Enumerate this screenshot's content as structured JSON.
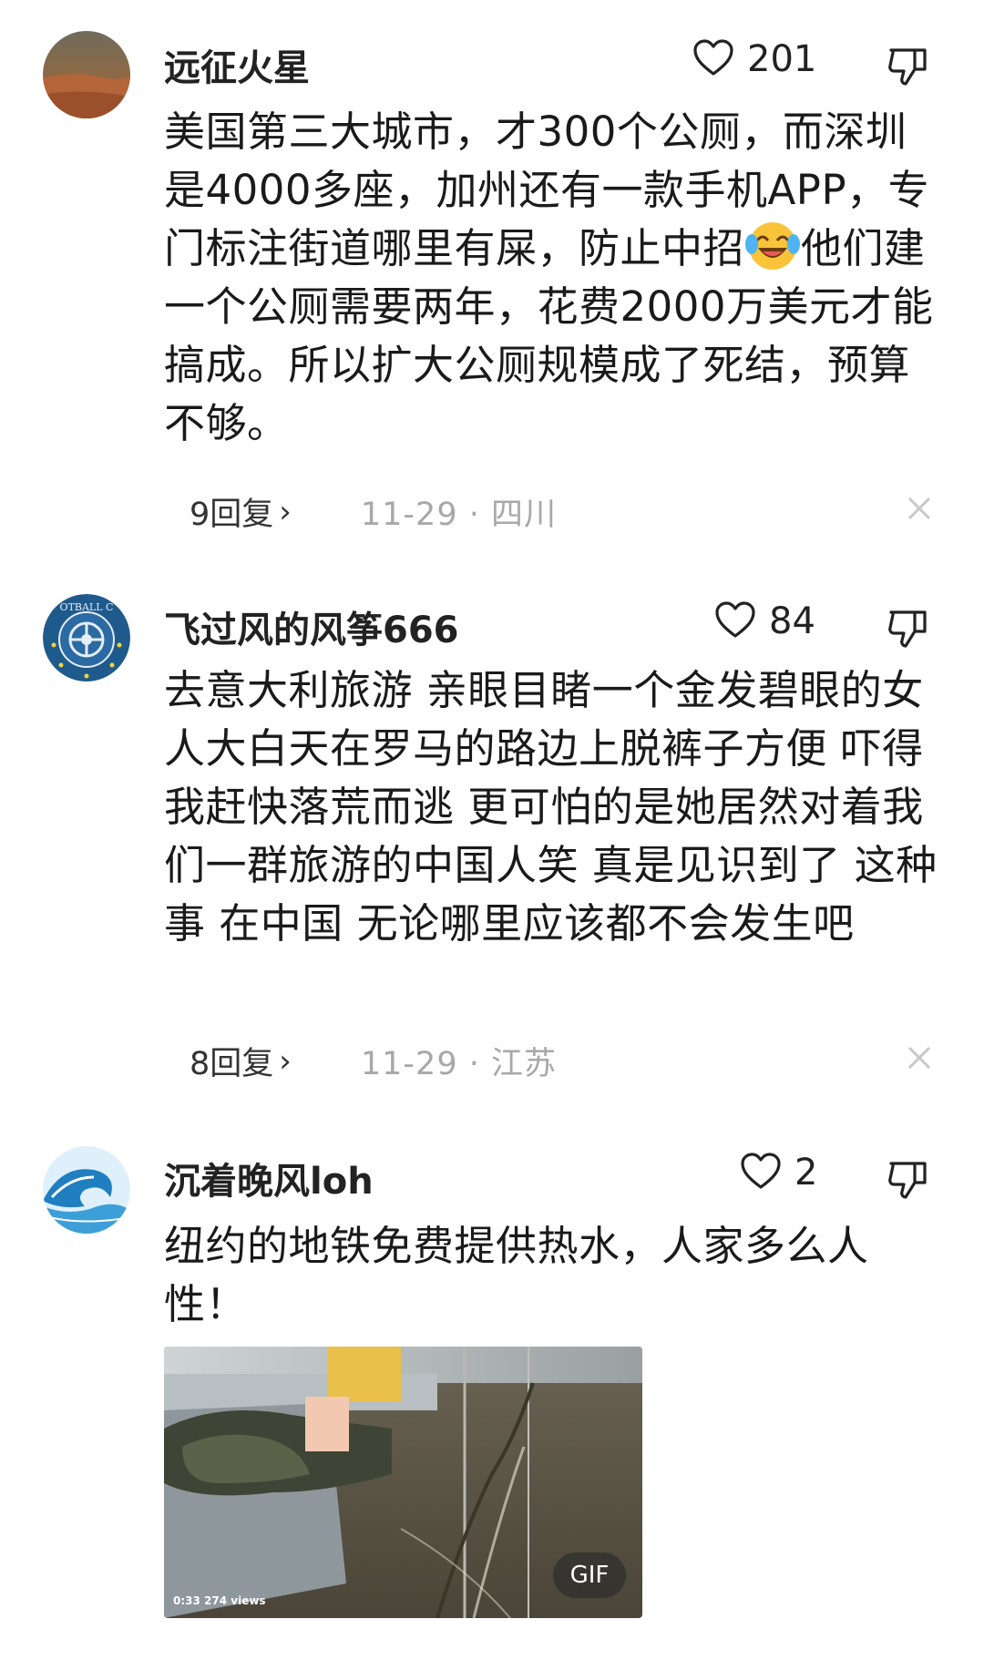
{
  "comments": [
    {
      "username": "远征火星",
      "likes": "201",
      "text_before_emoji": "美国第三大城市，才300个公厕，而深圳是4000多座，加州还有一款手机APP，专门标注街道哪里有屎，防止中招",
      "text_after_emoji": "他们建一个公厕需要两年，花费2000万美元才能搞成。所以扩大公厕规模成了死结，预算不够。",
      "replies": "9回复",
      "date_location": "11-29 · 四川",
      "emoji": "laughing-crying-emoji"
    },
    {
      "username": "飞过风的风筝666",
      "likes": "84",
      "text": "去意大利旅游 亲眼目睹一个金发碧眼的女人大白天在罗马的路边上脱裤子方便 吓得我赶快落荒而逃 更可怕的是她居然对着我们一群旅游的中国人笑 真是见识到了 这种事 在中国 无论哪里应该都不会发生吧",
      "replies": "8回复",
      "date_location": "11-29 · 江苏"
    },
    {
      "username": "沉着晚风loh",
      "likes": "2",
      "text": "纽约的地铁免费提供热水，人家多么人性！",
      "media": {
        "badge": "GIF",
        "video_info": "0:33  274 views"
      }
    }
  ],
  "icons": {
    "like": "heart-outline-icon",
    "dislike": "thumbs-down-outline-icon",
    "close": "close-icon",
    "chevron": "chevron-right-icon"
  },
  "colors": {
    "text": "#1a1a1a",
    "meta": "#a8a8a8"
  }
}
